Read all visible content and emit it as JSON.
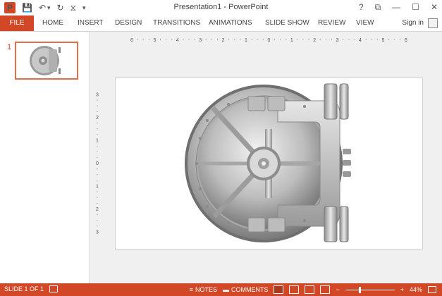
{
  "window": {
    "title": "Presentation1 - PowerPoint",
    "help_glyph": "?",
    "restore_glyph": "⧉",
    "min_glyph": "—",
    "max_glyph": "☐",
    "close_glyph": "✕"
  },
  "qat": {
    "app_icon": "P",
    "save_glyph": "💾",
    "undo_glyph": "↶",
    "undo_dropdown_glyph": "▾",
    "redo_glyph": "↻",
    "present_glyph": "⧖",
    "customize_glyph": "▾"
  },
  "ribbon": {
    "file_tab": "FILE",
    "tabs": [
      "HOME",
      "INSERT",
      "DESIGN",
      "TRANSITIONS",
      "ANIMATIONS",
      "SLIDE SHOW",
      "REVIEW",
      "VIEW"
    ],
    "sign_in": "Sign in"
  },
  "thumbnails": [
    {
      "number": "1"
    }
  ],
  "rulers": {
    "horizontal_ticks": [
      "6",
      "5",
      "4",
      "3",
      "2",
      "1",
      "0",
      "1",
      "2",
      "3",
      "4",
      "5",
      "6"
    ],
    "vertical_ticks": [
      "3",
      "2",
      "1",
      "0",
      "1",
      "2",
      "3"
    ]
  },
  "statusbar": {
    "slide_info": "SLIDE 1 OF 1",
    "notes_label": "NOTES",
    "comments_label": "COMMENTS",
    "zoom_minus": "−",
    "zoom_plus": "+",
    "zoom_level": "44%",
    "zoom_fraction": 0.44
  },
  "colors": {
    "accent": "#d24726",
    "thumb_border": "#e0704b"
  }
}
